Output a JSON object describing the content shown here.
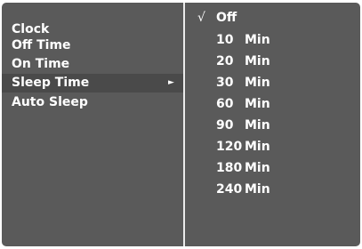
{
  "menu": {
    "items": [
      {
        "label": "Clock",
        "selected": false
      },
      {
        "label": "Off Time",
        "selected": false
      },
      {
        "label": "On Time",
        "selected": false
      },
      {
        "label": "Sleep Time",
        "selected": true,
        "submenu_indicator": "►"
      },
      {
        "label": "Auto Sleep",
        "selected": false
      }
    ]
  },
  "submenu": {
    "check_mark": "√",
    "options": [
      {
        "label": "Off",
        "checked": true
      },
      {
        "value": "10",
        "unit": "Min"
      },
      {
        "value": "20",
        "unit": "Min"
      },
      {
        "value": "30",
        "unit": "Min"
      },
      {
        "value": "60",
        "unit": "Min"
      },
      {
        "value": "90",
        "unit": "Min"
      },
      {
        "value": "120",
        "unit": "Min"
      },
      {
        "value": "180",
        "unit": "Min"
      },
      {
        "value": "240",
        "unit": "Min"
      }
    ]
  },
  "colors": {
    "background": "#5a5a5a",
    "selected_row": "#4a4a4a",
    "divider": "#ebebeb",
    "text": "#ffffff"
  }
}
